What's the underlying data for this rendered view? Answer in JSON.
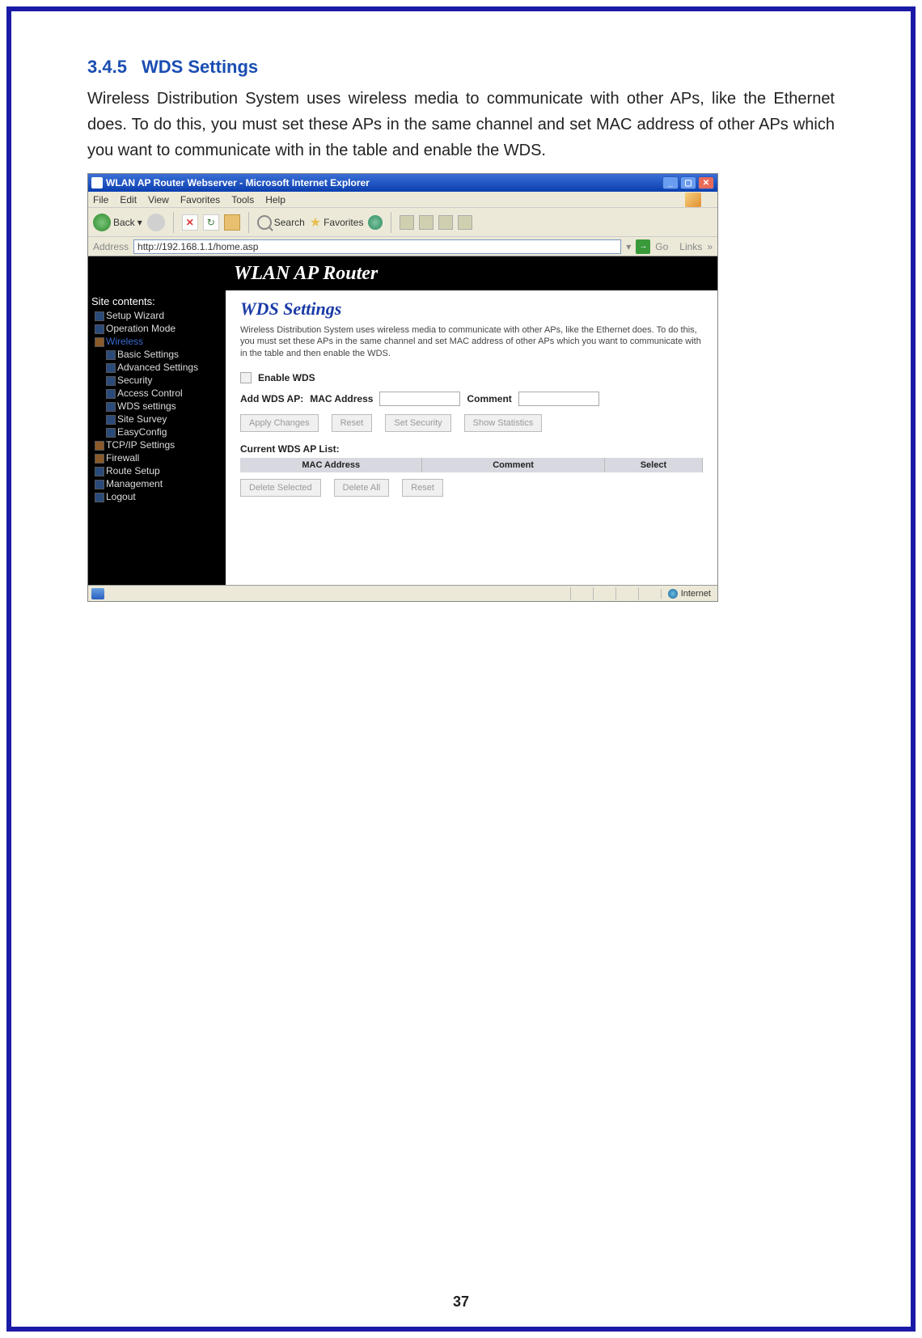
{
  "section": {
    "number": "3.4.5",
    "title": "WDS Settings"
  },
  "bodyText": "Wireless Distribution System uses wireless media to communicate with other APs, like the Ethernet does. To do this, you must set these APs in the same channel and set MAC address of other APs which you want to communicate with in the table and enable the WDS.",
  "browser": {
    "title": "WLAN AP Router Webserver - Microsoft Internet Explorer",
    "menu": {
      "file": "File",
      "edit": "Edit",
      "view": "View",
      "favorites": "Favorites",
      "tools": "Tools",
      "help": "Help"
    },
    "toolbar": {
      "back": "Back",
      "search": "Search",
      "favorites": "Favorites"
    },
    "addressLabel": "Address",
    "url": "http://192.168.1.1/home.asp",
    "go": "Go",
    "links": "Links",
    "statusZone": "Internet"
  },
  "banner": "WLAN AP Router",
  "sidebar": {
    "root": "Site contents:",
    "items": [
      {
        "label": "Setup Wizard"
      },
      {
        "label": "Operation Mode"
      },
      {
        "label": "Wireless",
        "active": true,
        "group": true
      },
      {
        "label": "Basic Settings",
        "sub": true
      },
      {
        "label": "Advanced Settings",
        "sub": true
      },
      {
        "label": "Security",
        "sub": true
      },
      {
        "label": "Access Control",
        "sub": true
      },
      {
        "label": "WDS settings",
        "sub": true
      },
      {
        "label": "Site Survey",
        "sub": true
      },
      {
        "label": "EasyConfig",
        "sub": true
      },
      {
        "label": "TCP/IP Settings",
        "group": true
      },
      {
        "label": "Firewall",
        "group": true
      },
      {
        "label": "Route Setup"
      },
      {
        "label": "Management"
      },
      {
        "label": "Logout"
      }
    ]
  },
  "page": {
    "h1": "WDS Settings",
    "desc": "Wireless Distribution System uses wireless media to communicate with other APs, like the Ethernet does. To do this, you must set these APs in the same channel and set MAC address of other APs which you want to communicate with in the table and then enable the WDS.",
    "enableLabel": "Enable WDS",
    "addLabel": "Add WDS AP:",
    "macLabel": "MAC Address",
    "commentLabel": "Comment",
    "btnApply": "Apply Changes",
    "btnReset": "Reset",
    "btnSecurity": "Set Security",
    "btnStats": "Show Statistics",
    "listHead": "Current WDS AP List:",
    "th": {
      "mac": "MAC Address",
      "comment": "Comment",
      "select": "Select"
    },
    "btnDelSel": "Delete Selected",
    "btnDelAll": "Delete All",
    "btnReset2": "Reset"
  },
  "pageNumber": "37"
}
